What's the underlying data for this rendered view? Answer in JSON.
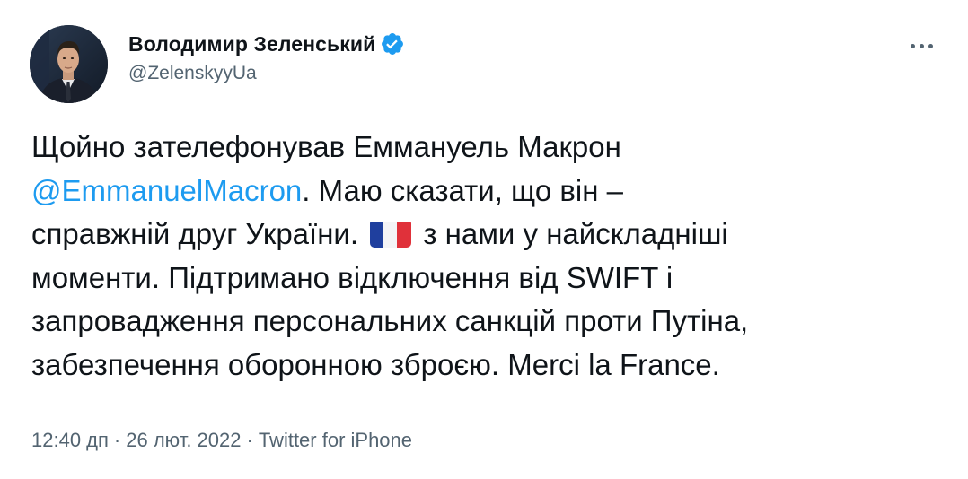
{
  "author": {
    "display_name": "Володимир Зеленський",
    "handle": "@ZelenskyyUa",
    "verified": true
  },
  "icons": {
    "avatar": "profile-photo",
    "verified": "verified-badge-icon",
    "more": "more-options-icon",
    "flag": "france-flag-emoji"
  },
  "colors": {
    "link": "#1d9bf0",
    "secondary_text": "#536471",
    "primary_text": "#0f1419"
  },
  "tweet": {
    "text_before_mention": "Щойно зателефонував Еммануель Макрон\n",
    "mention": "@EmmanuelMacron",
    "text_after_mention": ". Маю сказати, що він –\nсправжній друг України. ",
    "text_after_flag": " з нами у найскладніші\nмоменти. Підтримано відключення від SWIFT і\nзапровадження персональних санкцій проти Путіна,\nзабезпечення оборонною зброєю. Merci la France."
  },
  "meta": {
    "time": "12:40 дп",
    "date": "26 лют. 2022",
    "separator": "·",
    "source": "Twitter for iPhone"
  }
}
